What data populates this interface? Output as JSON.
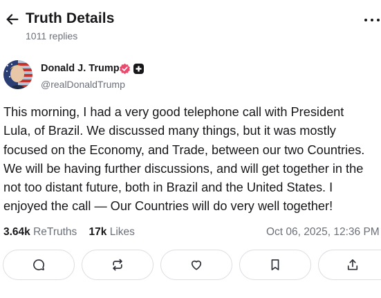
{
  "header": {
    "title": "Truth Details",
    "replies": "1011 replies"
  },
  "author": {
    "name": "Donald J. Trump",
    "handle": "@realDonaldTrump"
  },
  "post": {
    "text": "This morning, I had a very good telephone call with President\nLula, of Brazil. We discussed many things, but it was mostly\nfocused on the Economy, and Trade, between our two Countries.\nWe will be having further discussions, and will get together in the\nnot too distant future, both in Brazil and the United States. I\nenjoyed the call — Our Countries will do very well together!"
  },
  "stats": {
    "retruths_count": "3.64k",
    "retruths_label": "ReTruths",
    "likes_count": "17k",
    "likes_label": "Likes",
    "timestamp": "Oct 06, 2025, 12:36 PM"
  },
  "icons": {
    "back": "arrow-left-icon",
    "more": "more-horizontal-icon",
    "verified": "verified-badge-icon",
    "plus": "plus-badge-icon",
    "reply": "reply-icon",
    "retruth": "retruth-icon",
    "like": "heart-icon",
    "bookmark": "bookmark-icon",
    "share": "share-icon"
  },
  "colors": {
    "verified": "#e74c6f",
    "muted_text": "#6b6f78",
    "border": "#dcdde1"
  }
}
